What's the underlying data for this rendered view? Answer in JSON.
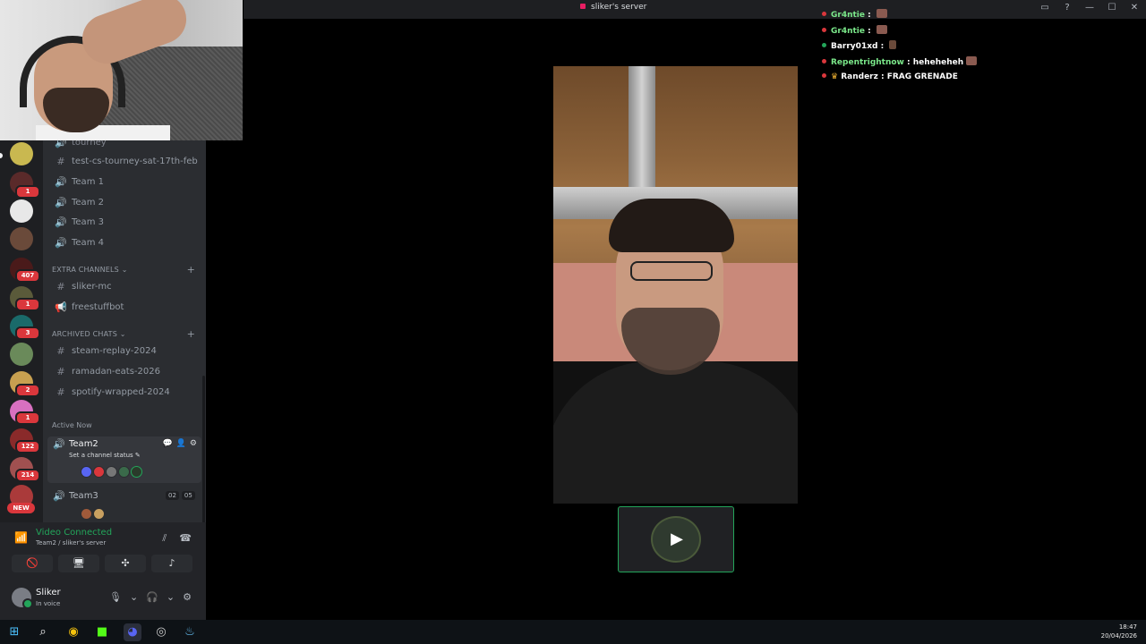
{
  "titlebar": {
    "server_name": "sliker's server",
    "buttons": [
      "inbox-icon",
      "help-icon",
      "minimize-icon",
      "maximize-icon",
      "close-icon"
    ],
    "minimize": "—",
    "maximize": "☐",
    "close": "✕"
  },
  "chat_overlay": {
    "messages": [
      {
        "user": "Gr4ntie",
        "text": " : ",
        "color": "#7be88a"
      },
      {
        "user": "Gr4ntie",
        "text": " : ",
        "color": "#7be88a"
      },
      {
        "user": "Barry01xd",
        "text": " : ",
        "color": "#ffffff"
      },
      {
        "user": "Repentrightnow",
        "text": " : heheheheh",
        "color": "#7be88a"
      },
      {
        "user": "Randerz",
        "text": " : FRAG GRENADE",
        "color": "#ffffff"
      }
    ]
  },
  "server_rail": {
    "badges": [
      "1",
      "407",
      "1",
      "3",
      "2",
      "1",
      "122",
      "214"
    ],
    "new_label": "NEW"
  },
  "channels": {
    "partial_top": "tourney",
    "items": [
      {
        "icon": "#",
        "name": "test-cs-tourney-sat-17th-feb"
      },
      {
        "icon": "🔊",
        "name": "Team 1"
      },
      {
        "icon": "🔊",
        "name": "Team 2"
      },
      {
        "icon": "🔊",
        "name": "Team 3"
      },
      {
        "icon": "🔊",
        "name": "Team 4"
      }
    ],
    "extra_category": "EXTRA CHANNELS",
    "extra_items": [
      {
        "icon": "#",
        "name": "sliker-mc"
      },
      {
        "icon": "📢",
        "name": "freestuffbot"
      }
    ],
    "archived_category": "ARCHIVED CHATS",
    "archived_items": [
      {
        "icon": "#",
        "name": "steam-replay-2024"
      },
      {
        "icon": "#",
        "name": "ramadan-eats-2026"
      },
      {
        "icon": "#",
        "name": "spotify-wrapped-2024"
      }
    ],
    "active_now": "Active Now",
    "team2": {
      "name": "Team2",
      "status": "Set a channel status"
    },
    "team3": {
      "name": "Team3",
      "count_a": "02",
      "count_b": "05"
    }
  },
  "voice_panel": {
    "title": "Video Connected",
    "subtitle": "Team2 / sliker's server"
  },
  "user": {
    "name": "Sliker",
    "status": "In voice"
  },
  "taskbar": {
    "time": "18:47",
    "date": "20/04/2026"
  },
  "colors": {
    "accent_green": "#23a55a",
    "badge_red": "#da373c",
    "sidebar": "#2b2d31",
    "rail": "#1e1f22"
  }
}
